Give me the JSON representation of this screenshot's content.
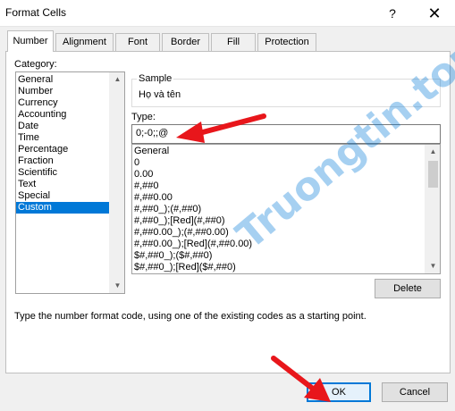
{
  "window": {
    "title": "Format Cells",
    "help_label": "?",
    "close_label": "✕"
  },
  "tabs": [
    {
      "label": "Number",
      "active": true
    },
    {
      "label": "Alignment"
    },
    {
      "label": "Font"
    },
    {
      "label": "Border"
    },
    {
      "label": "Fill"
    },
    {
      "label": "Protection"
    }
  ],
  "category": {
    "label": "Category:",
    "items": [
      "General",
      "Number",
      "Currency",
      "Accounting",
      "Date",
      "Time",
      "Percentage",
      "Fraction",
      "Scientific",
      "Text",
      "Special",
      "Custom"
    ],
    "selected": "Custom"
  },
  "sample": {
    "label": "Sample",
    "value": "Họ và tên"
  },
  "type": {
    "label": "Type:",
    "value": "0;-0;;@",
    "formats": [
      "General",
      "0",
      "0.00",
      "#,##0",
      "#,##0.00",
      "#,##0_);(#,##0)",
      "#,##0_);[Red](#,##0)",
      "#,##0.00_);(#,##0.00)",
      "#,##0.00_);[Red](#,##0.00)",
      "$#,##0_);($#,##0)",
      "$#,##0_);[Red]($#,##0)"
    ]
  },
  "buttons": {
    "delete": "Delete",
    "ok": "OK",
    "cancel": "Cancel"
  },
  "hint": "Type the number format code, using one of the existing codes as a starting point.",
  "watermark": "Truongtin.top",
  "colors": {
    "selection": "#0078d7",
    "arrow": "#e8161b",
    "watermark": "#0078d7"
  }
}
